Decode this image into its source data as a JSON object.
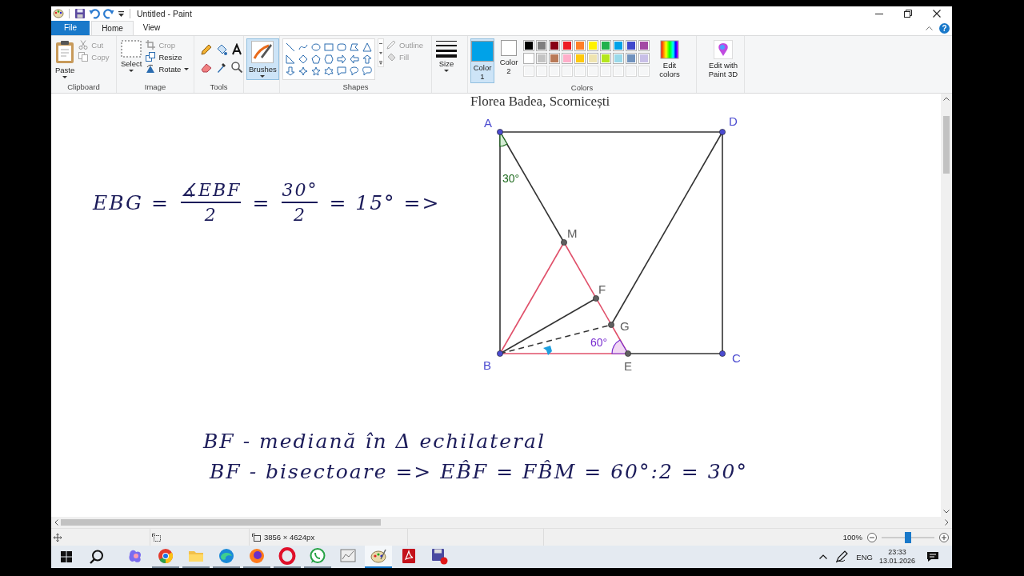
{
  "window": {
    "title": "Untitled - Paint"
  },
  "ribbon_tabs": [
    {
      "label": "File",
      "kind": "file",
      "selected": false
    },
    {
      "label": "Home",
      "kind": "tab",
      "selected": true
    },
    {
      "label": "View",
      "kind": "tab",
      "selected": false
    }
  ],
  "help": "?",
  "clipboard": {
    "paste": "Paste",
    "cut": {
      "label": "Cut",
      "disabled": true
    },
    "copy": {
      "label": "Copy",
      "disabled": true
    },
    "group": "Clipboard"
  },
  "image": {
    "select": "Select",
    "crop": {
      "label": "Crop",
      "disabled": true
    },
    "resize": {
      "label": "Resize",
      "disabled": false
    },
    "rotate": {
      "label": "Rotate",
      "disabled": false
    },
    "group": "Image"
  },
  "tools": {
    "group": "Tools"
  },
  "brushes": {
    "label": "Brushes",
    "selected": true
  },
  "shapes": {
    "outline": {
      "label": "Outline",
      "disabled": true
    },
    "fill": {
      "label": "Fill",
      "disabled": true
    },
    "group": "Shapes"
  },
  "size": {
    "label": "Size"
  },
  "colors": {
    "color_1": {
      "label": "Color 1",
      "color": "#00a2e8",
      "selected": true
    },
    "color_2": {
      "label": "Color 2",
      "color": "#ffffff",
      "selected": false
    },
    "palette": [
      {
        "color": "#000000"
      },
      {
        "color": "#7f7f7f"
      },
      {
        "color": "#880015"
      },
      {
        "color": "#ed1c24"
      },
      {
        "color": "#ff7f27"
      },
      {
        "color": "#fff200"
      },
      {
        "color": "#22b14c"
      },
      {
        "color": "#00a2e8"
      },
      {
        "color": "#3f48cc"
      },
      {
        "color": "#a349a4"
      },
      {
        "color": "#ffffff"
      },
      {
        "color": "#c3c3c3"
      },
      {
        "color": "#b97a57"
      },
      {
        "color": "#ffaec9"
      },
      {
        "color": "#ffc90e"
      },
      {
        "color": "#efe4b0"
      },
      {
        "color": "#b5e61d"
      },
      {
        "color": "#99d9ea"
      },
      {
        "color": "#7092be"
      },
      {
        "color": "#c8bfe7"
      }
    ],
    "edit": "Edit colors",
    "group": "Colors"
  },
  "paint3d": {
    "label": "Edit with Paint 3D"
  },
  "canvas": {
    "header": "Florea Badea, Scornicești",
    "formula": [
      {
        "kind": "text",
        "text": "EBG ="
      },
      {
        "kind": "fraction",
        "numerator": "∡EBF",
        "denominator": "2"
      },
      {
        "kind": "text",
        "text": "="
      },
      {
        "kind": "fraction",
        "numerator": "30°",
        "denominator": "2"
      },
      {
        "kind": "text",
        "text": "= 15° =>"
      }
    ],
    "lines": [
      "BF - mediană în Δ echilateral",
      "BF - bisectoare => EB̂F = FB̂M = 60°:2 = 30°"
    ],
    "diagram": {
      "points": [
        {
          "label": "A",
          "color": "#4b4bd0"
        },
        {
          "label": "D",
          "color": "#4b4bd0"
        },
        {
          "label": "C",
          "color": "#4b4bd0"
        },
        {
          "label": "B",
          "color": "#4b4bd0"
        },
        {
          "label": "E",
          "color": "#606060"
        },
        {
          "label": "M",
          "color": "#606060"
        },
        {
          "label": "F",
          "color": "#606060"
        },
        {
          "label": "G",
          "color": "#606060"
        }
      ],
      "angles": [
        {
          "label": "30°",
          "color": "#1f6b1f"
        },
        {
          "label": "60°",
          "color": "#7a2fd0"
        }
      ]
    }
  },
  "status_bar": {
    "dimensions": "3856 × 4624px",
    "zoom": "100%",
    "zoom_slider": {
      "level": 0.5
    }
  },
  "taskbar": {
    "apps": [
      {
        "running": false,
        "selected": false
      },
      {
        "running": true,
        "selected": false
      },
      {
        "running": true,
        "selected": false
      },
      {
        "running": true,
        "selected": false
      },
      {
        "running": true,
        "selected": false
      },
      {
        "running": true,
        "selected": false
      },
      {
        "running": true,
        "selected": false
      },
      {
        "running": false,
        "selected": false
      },
      {
        "running": true,
        "selected": true
      },
      {
        "running": false,
        "selected": false
      },
      {
        "running": false,
        "selected": false
      }
    ],
    "language": "ENG",
    "time": "23:33",
    "date": "13.01.2026"
  }
}
